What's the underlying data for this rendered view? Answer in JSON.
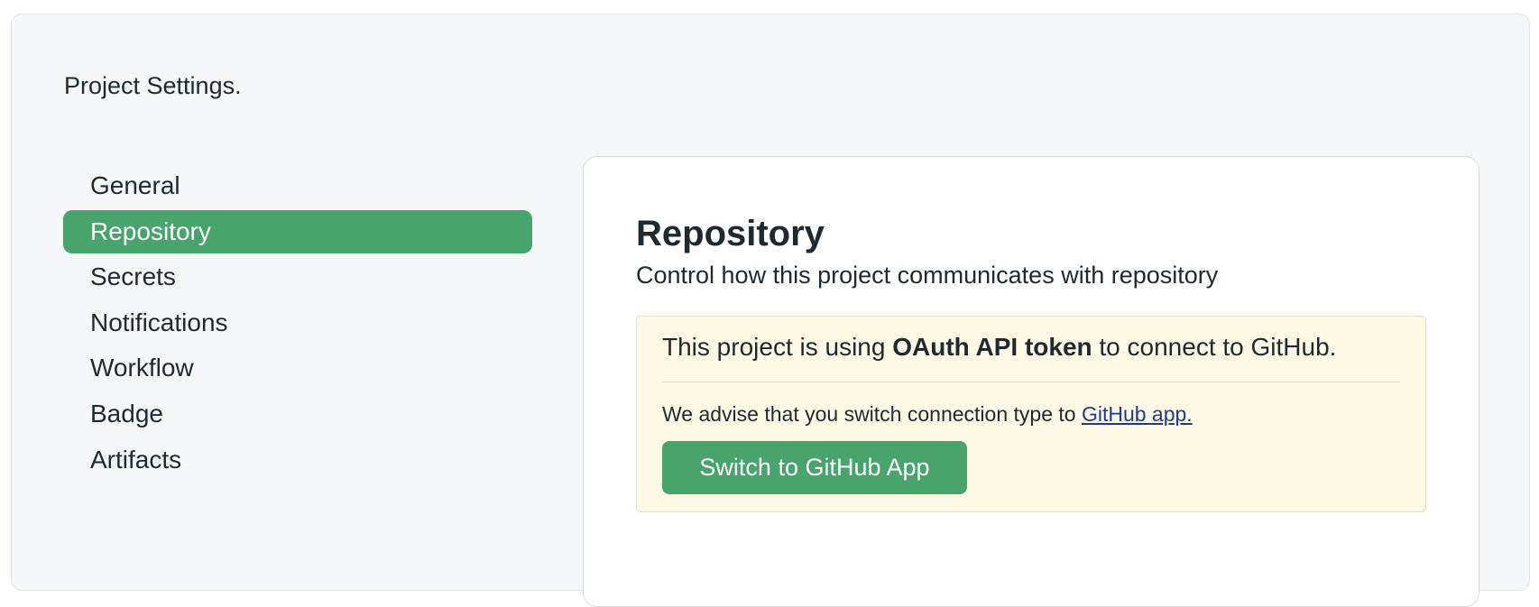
{
  "header": {
    "title": "Project Settings."
  },
  "sidebar": {
    "items": [
      {
        "label": "General"
      },
      {
        "label": "Repository",
        "active": true
      },
      {
        "label": "Secrets"
      },
      {
        "label": "Notifications"
      },
      {
        "label": "Workflow"
      },
      {
        "label": "Badge"
      },
      {
        "label": "Artifacts"
      }
    ]
  },
  "main": {
    "title": "Repository",
    "subtitle": "Control how this project communicates with repository",
    "notice": {
      "prefix": "This project is using ",
      "emphasis": "OAuth API token",
      "suffix": " to connect to GitHub.",
      "advise_text": "We advise that you switch connection type to ",
      "advise_link": "GitHub app.",
      "button_label": "Switch to GitHub App"
    }
  },
  "colors": {
    "accent": "#48a46c",
    "notice_background": "#fdf9e6",
    "link": "#1f3c8c"
  }
}
